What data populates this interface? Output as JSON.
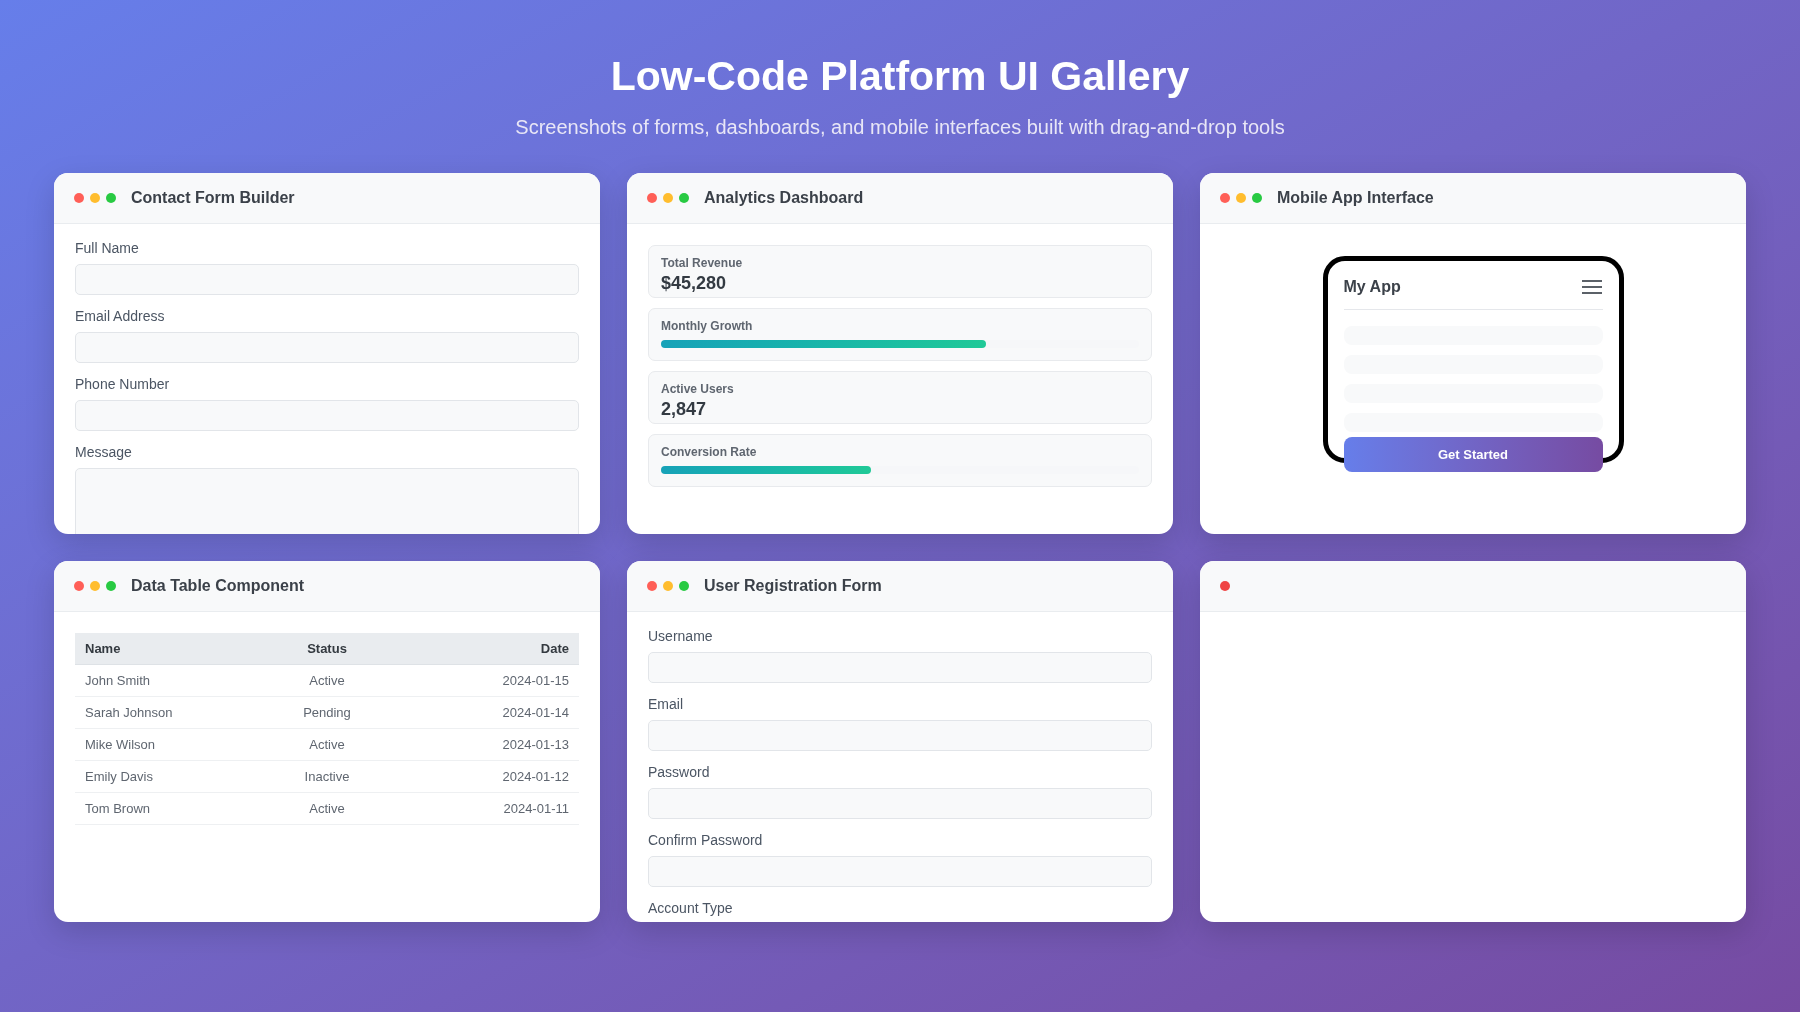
{
  "header": {
    "title": "Low-Code Platform UI Gallery",
    "subtitle": "Screenshots of forms, dashboards, and mobile interfaces built with drag-and-drop tools"
  },
  "cards": [
    {
      "kind": "form",
      "title": "Contact Form Builder",
      "dots": [
        {
          "color": "#ff5f57"
        },
        {
          "color": "#ffbd2e"
        },
        {
          "color": "#28ca42"
        }
      ],
      "fields": [
        {
          "label": "Full Name",
          "kind": "input"
        },
        {
          "label": "Email Address",
          "kind": "input"
        },
        {
          "label": "Phone Number",
          "kind": "input"
        },
        {
          "label": "Message",
          "kind": "textarea"
        }
      ]
    },
    {
      "kind": "stats",
      "title": "Analytics Dashboard",
      "dots": [
        {
          "color": "#ff5f57"
        },
        {
          "color": "#ffbd2e"
        },
        {
          "color": "#28ca42"
        }
      ],
      "stats": [
        {
          "kind": "value",
          "label": "Total Revenue",
          "value": "$45,280"
        },
        {
          "kind": "progress",
          "label": "Monthly Growth",
          "level": 0.68
        },
        {
          "kind": "value",
          "label": "Active Users",
          "value": "2,847"
        },
        {
          "kind": "progress",
          "label": "Conversion Rate",
          "level": 0.44
        }
      ]
    },
    {
      "kind": "mobile",
      "title": "Mobile App Interface",
      "dots": [
        {
          "color": "#ff5f57"
        },
        {
          "color": "#ffbd2e"
        },
        {
          "color": "#28ca42"
        }
      ],
      "app": {
        "title": "My App",
        "button": "Get Started"
      }
    },
    {
      "kind": "table",
      "title": "Data Table Component",
      "dots": [
        {
          "color": "#ff5f57"
        },
        {
          "color": "#ffbd2e"
        },
        {
          "color": "#28ca42"
        }
      ],
      "columns": [
        "Name",
        "Status",
        "Date"
      ],
      "rows": [
        [
          "John Smith",
          "Active",
          "2024-01-15"
        ],
        [
          "Sarah Johnson",
          "Pending",
          "2024-01-14"
        ],
        [
          "Mike Wilson",
          "Active",
          "2024-01-13"
        ],
        [
          "Emily Davis",
          "Inactive",
          "2024-01-12"
        ],
        [
          "Tom Brown",
          "Active",
          "2024-01-11"
        ]
      ]
    },
    {
      "kind": "form",
      "title": "User Registration Form",
      "dots": [
        {
          "color": "#ff5f57"
        },
        {
          "color": "#ffbd2e"
        },
        {
          "color": "#28ca42"
        }
      ],
      "fields": [
        {
          "label": "Username",
          "kind": "input"
        },
        {
          "label": "Email",
          "kind": "input"
        },
        {
          "label": "Password",
          "kind": "input"
        },
        {
          "label": "Confirm Password",
          "kind": "input"
        },
        {
          "label": "Account Type",
          "kind": "label"
        }
      ]
    },
    {
      "kind": "blank",
      "dots": [
        {
          "color": "#ef4444"
        }
      ]
    }
  ]
}
